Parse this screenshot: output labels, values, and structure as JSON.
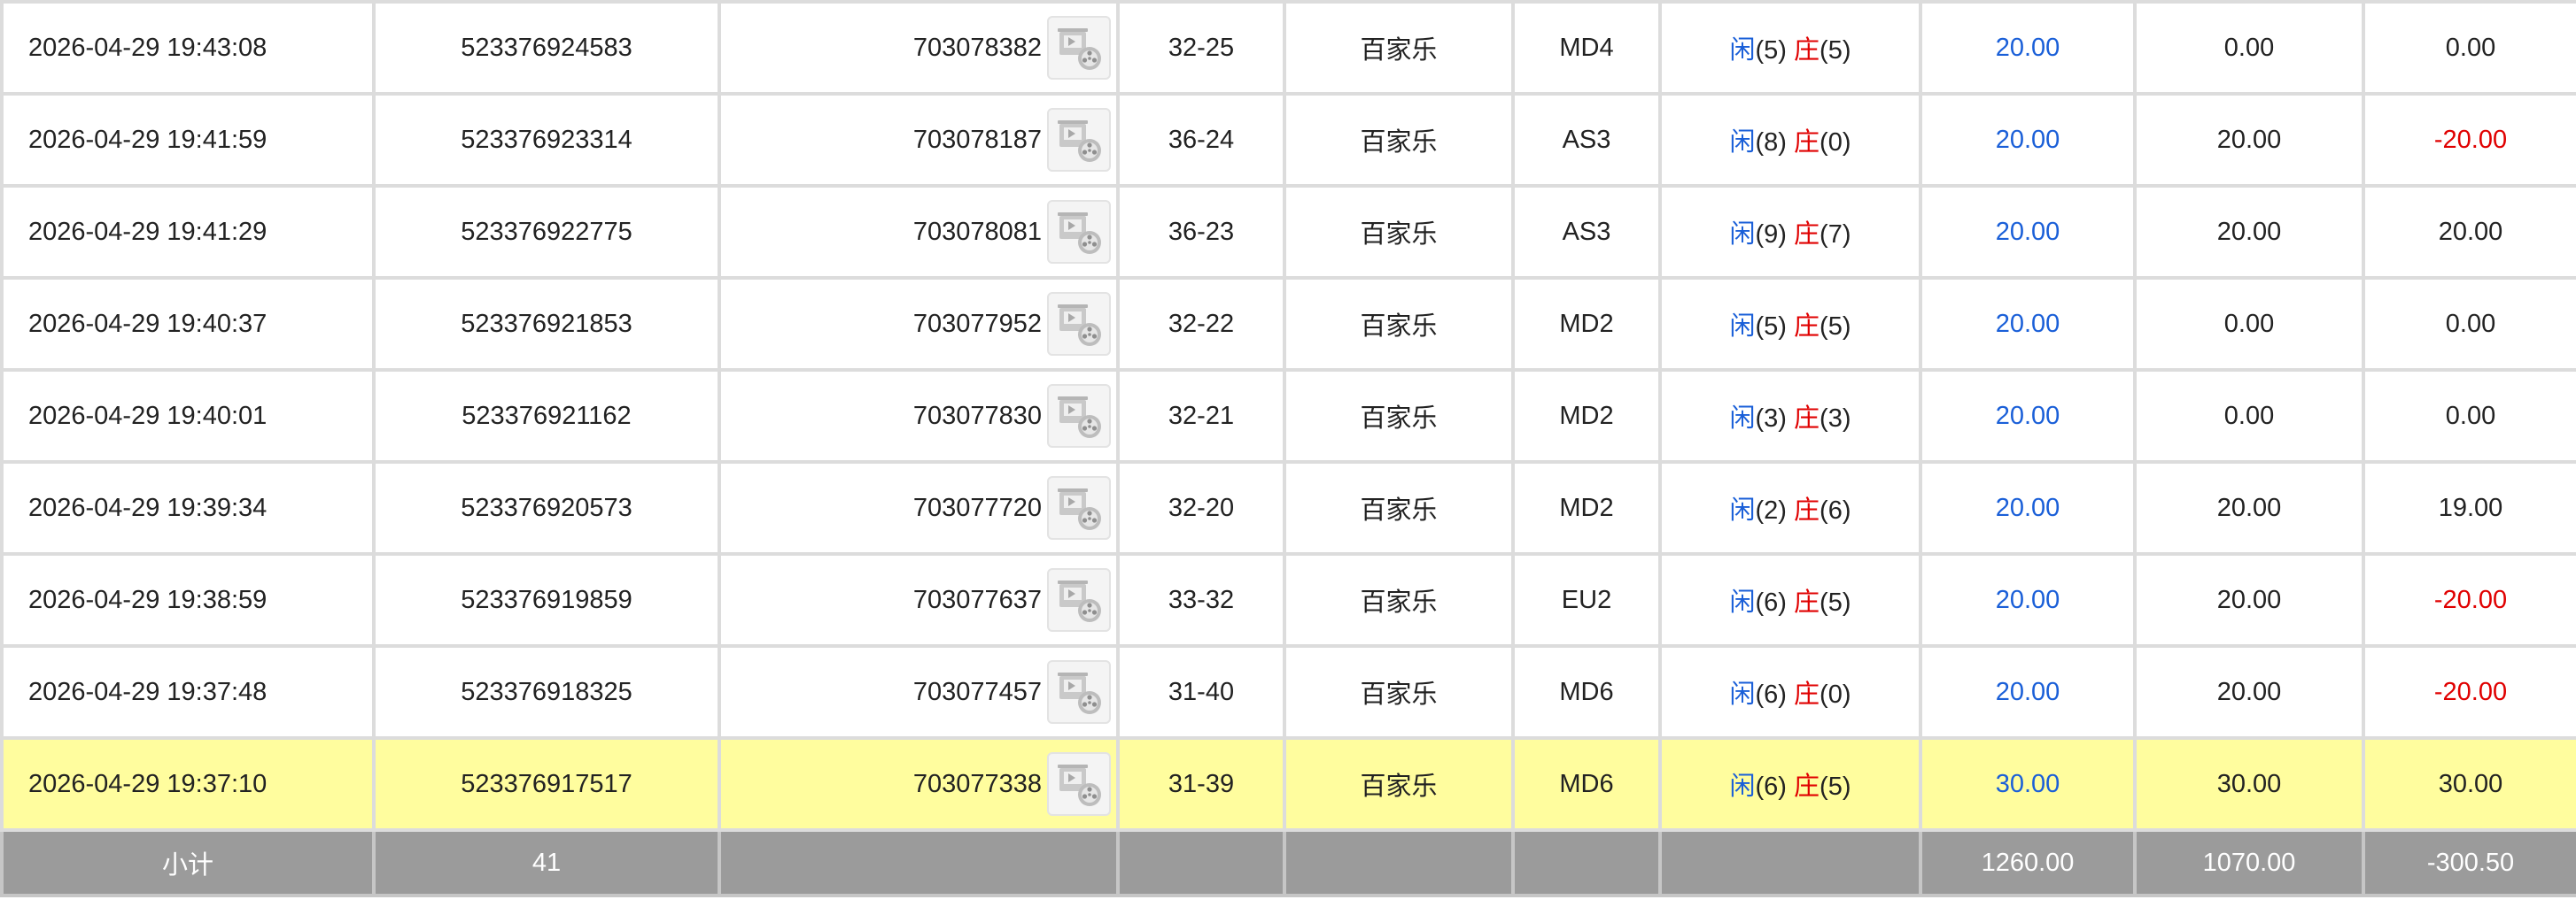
{
  "colors": {
    "player": "#1a5fd8",
    "banker": "#e00000",
    "highlight_row": "#fffd9e",
    "total_row": "#9b9b9b",
    "negative": "#e00000",
    "valid_bet": "#1a5fd8"
  },
  "rows": [
    {
      "time": "2026-04-29 19:43:08",
      "order_id": "523376924583",
      "bet_id": "703078382",
      "icon": "video-replay-icon",
      "round": "32-25",
      "game": "百家乐",
      "table": "MD4",
      "p_label": "闲",
      "p_score": "(5)",
      "b_label": "庄",
      "b_score": "(5)",
      "valid_bet": "20.00",
      "bet": "0.00",
      "payout": "0.00",
      "payout_neg": false,
      "highlight": false
    },
    {
      "time": "2026-04-29 19:41:59",
      "order_id": "523376923314",
      "bet_id": "703078187",
      "icon": "video-replay-icon",
      "round": "36-24",
      "game": "百家乐",
      "table": "AS3",
      "p_label": "闲",
      "p_score": "(8)",
      "b_label": "庄",
      "b_score": "(0)",
      "valid_bet": "20.00",
      "bet": "20.00",
      "payout": "-20.00",
      "payout_neg": true,
      "highlight": false
    },
    {
      "time": "2026-04-29 19:41:29",
      "order_id": "523376922775",
      "bet_id": "703078081",
      "icon": "video-replay-icon",
      "round": "36-23",
      "game": "百家乐",
      "table": "AS3",
      "p_label": "闲",
      "p_score": "(9)",
      "b_label": "庄",
      "b_score": "(7)",
      "valid_bet": "20.00",
      "bet": "20.00",
      "payout": "20.00",
      "payout_neg": false,
      "highlight": false
    },
    {
      "time": "2026-04-29 19:40:37",
      "order_id": "523376921853",
      "bet_id": "703077952",
      "icon": "video-replay-icon",
      "round": "32-22",
      "game": "百家乐",
      "table": "MD2",
      "p_label": "闲",
      "p_score": "(5)",
      "b_label": "庄",
      "b_score": "(5)",
      "valid_bet": "20.00",
      "bet": "0.00",
      "payout": "0.00",
      "payout_neg": false,
      "highlight": false
    },
    {
      "time": "2026-04-29 19:40:01",
      "order_id": "523376921162",
      "bet_id": "703077830",
      "icon": "video-replay-icon",
      "round": "32-21",
      "game": "百家乐",
      "table": "MD2",
      "p_label": "闲",
      "p_score": "(3)",
      "b_label": "庄",
      "b_score": "(3)",
      "valid_bet": "20.00",
      "bet": "0.00",
      "payout": "0.00",
      "payout_neg": false,
      "highlight": false
    },
    {
      "time": "2026-04-29 19:39:34",
      "order_id": "523376920573",
      "bet_id": "703077720",
      "icon": "video-replay-icon",
      "round": "32-20",
      "game": "百家乐",
      "table": "MD2",
      "p_label": "闲",
      "p_score": "(2)",
      "b_label": "庄",
      "b_score": "(6)",
      "valid_bet": "20.00",
      "bet": "20.00",
      "payout": "19.00",
      "payout_neg": false,
      "highlight": false
    },
    {
      "time": "2026-04-29 19:38:59",
      "order_id": "523376919859",
      "bet_id": "703077637",
      "icon": "video-replay-icon",
      "round": "33-32",
      "game": "百家乐",
      "table": "EU2",
      "p_label": "闲",
      "p_score": "(6)",
      "b_label": "庄",
      "b_score": "(5)",
      "valid_bet": "20.00",
      "bet": "20.00",
      "payout": "-20.00",
      "payout_neg": true,
      "highlight": false
    },
    {
      "time": "2026-04-29 19:37:48",
      "order_id": "523376918325",
      "bet_id": "703077457",
      "icon": "video-replay-icon",
      "round": "31-40",
      "game": "百家乐",
      "table": "MD6",
      "p_label": "闲",
      "p_score": "(6)",
      "b_label": "庄",
      "b_score": "(0)",
      "valid_bet": "20.00",
      "bet": "20.00",
      "payout": "-20.00",
      "payout_neg": true,
      "highlight": false
    },
    {
      "time": "2026-04-29 19:37:10",
      "order_id": "523376917517",
      "bet_id": "703077338",
      "icon": "video-replay-icon",
      "round": "31-39",
      "game": "百家乐",
      "table": "MD6",
      "p_label": "闲",
      "p_score": "(6)",
      "b_label": "庄",
      "b_score": "(5)",
      "valid_bet": "30.00",
      "bet": "30.00",
      "payout": "30.00",
      "payout_neg": false,
      "highlight": true
    }
  ],
  "total": {
    "label": "小计",
    "count": "41",
    "valid_bet": "1260.00",
    "bet": "1070.00",
    "payout": "-300.50"
  }
}
